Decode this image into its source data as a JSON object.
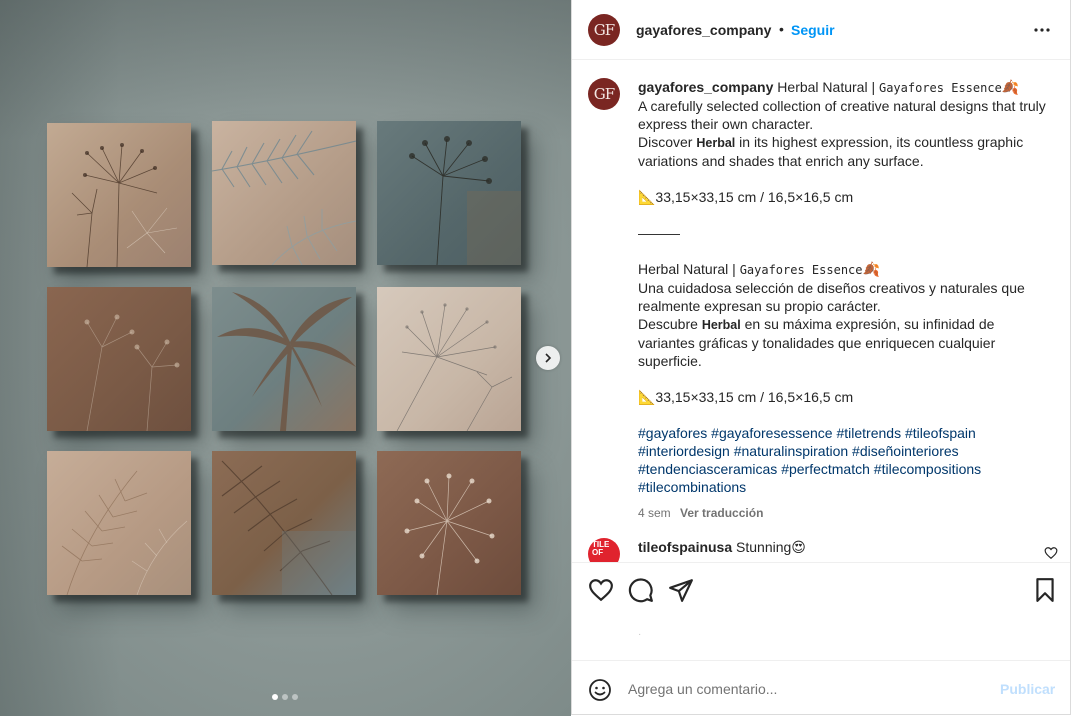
{
  "post": {
    "username": "gayafores_company",
    "avatar_initials": "GF",
    "follow_label": "Seguir",
    "separator": "•"
  },
  "caption": {
    "username": "gayafores_company",
    "title_plain": "Herbal Natural |",
    "title_brand": "Gayafores Essence",
    "leaf_emoji": "🍂",
    "en_line1": "A carefully selected collection of creative natural designs that truly express their own character.",
    "en_line2_prefix": "Discover",
    "en_line2_bold": "Herbal",
    "en_line2_suffix": "in its highest expression, its countless graphic variations and shades that enrich any surface.",
    "size_en": "📐33,15×33,15 cm / 16,5×16,5 cm",
    "divider": "———",
    "es_title_plain": "Herbal Natural |",
    "es_title_brand": "Gayafores Essence",
    "es_line1": "Una cuidadosa selección de diseños creativos y naturales que realmente expresan su propio carácter.",
    "es_line2_prefix": "Descubre",
    "es_line2_bold": "Herbal",
    "es_line2_suffix": "en su máxima expresión, su infinidad de variantes gráficas y tonalidades que enriquecen cualquier superficie.",
    "size_es": "📐33,15×33,15 cm / 16,5×16,5 cm",
    "hashtags": [
      "#gayafores",
      "#gayaforesessence",
      "#tiletrends",
      "#tileofspain",
      "#interiordesign",
      "#naturalinspiration",
      "#diseñointeriores",
      "#tendenciasceramicas",
      "#perfectmatch",
      "#tilecompositions",
      "#tilecombinations"
    ],
    "time_ago": "4 sem",
    "translate_label": "Ver traducción"
  },
  "comment": {
    "username": "tileofspainusa",
    "text": "Stunning😍",
    "avatar_text": "TILE OF"
  },
  "actions": {
    "like_icon": "heart-icon",
    "comment_icon": "comment-icon",
    "share_icon": "paper-plane-icon",
    "save_icon": "bookmark-icon",
    "stray_mark": "·"
  },
  "add_comment": {
    "placeholder": "Agrega un comentario...",
    "post_label": "Publicar"
  },
  "carousel": {
    "slide_count": 3,
    "active_index": 0
  },
  "colors": {
    "link_blue": "#0095f6",
    "hashtag_blue": "#00376b",
    "avatar_red": "#7a2622"
  }
}
